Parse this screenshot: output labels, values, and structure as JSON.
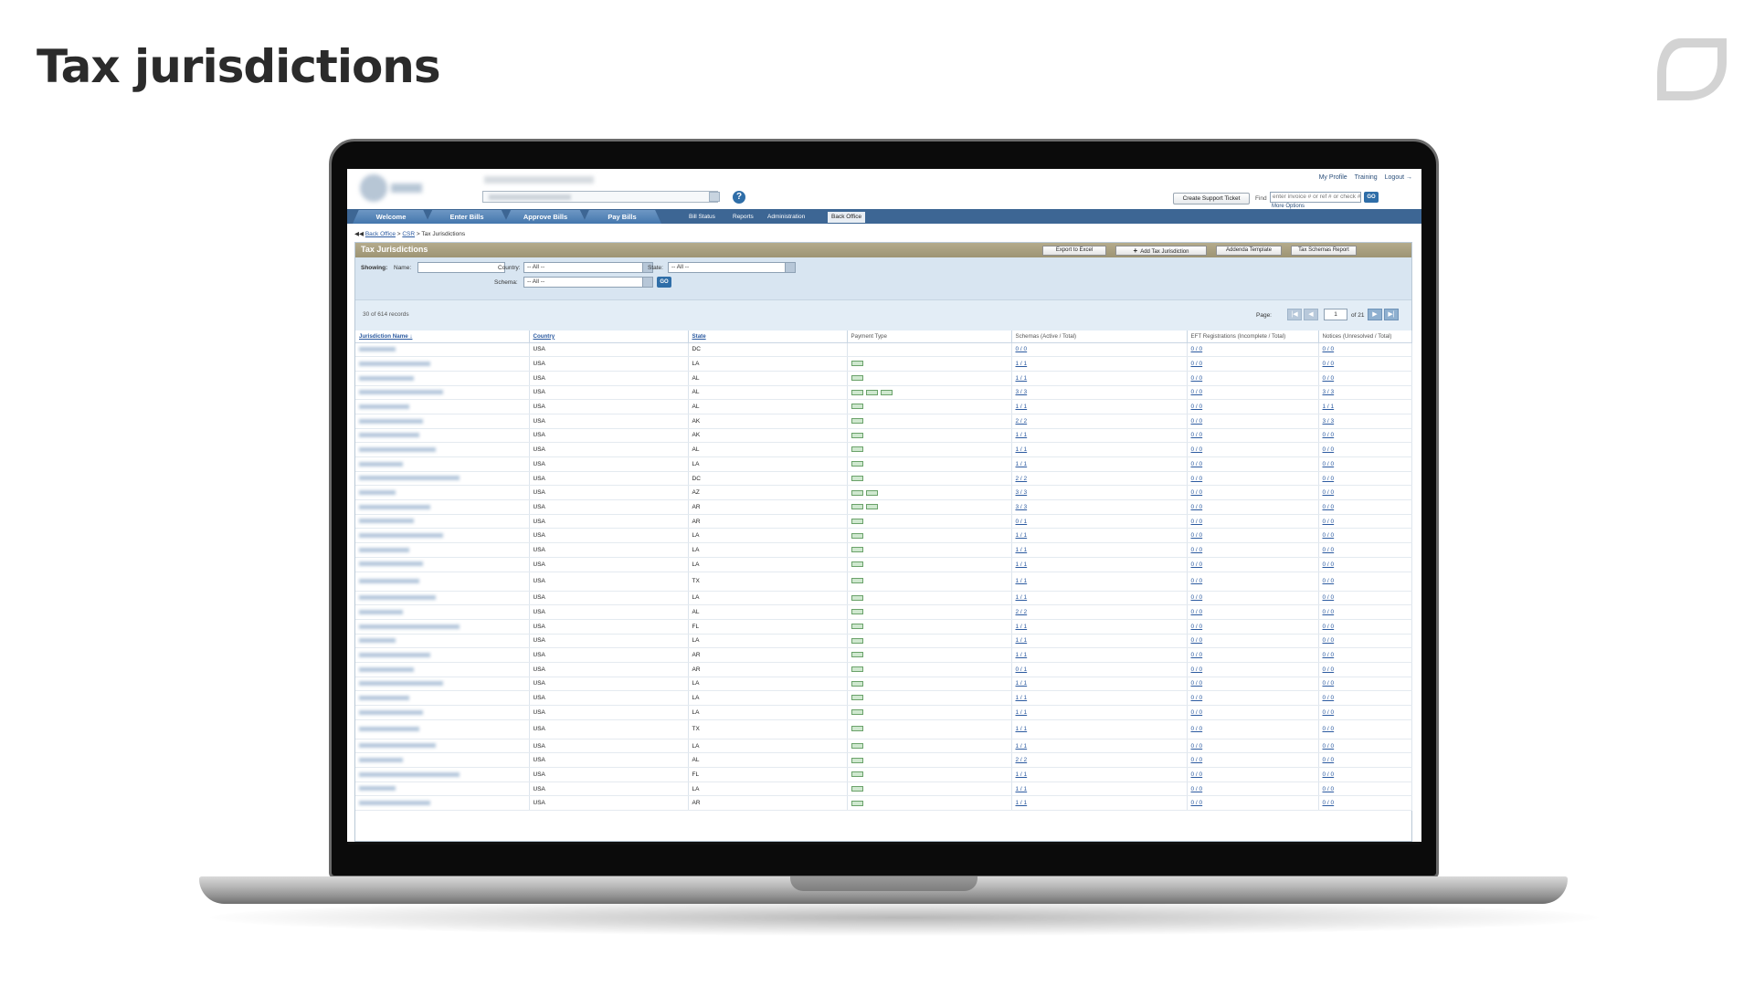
{
  "slide": {
    "title": "Tax jurisdictions"
  },
  "app": {
    "toplinks": [
      "My Profile",
      "Training",
      "Logout →"
    ],
    "help_label": "?",
    "support_button": "Create Support Ticket",
    "find_label": "Find",
    "find_placeholder": "enter invoice # or ref # or check #",
    "find_go": "GO",
    "more_options": "More Options",
    "nav_tabs": [
      "Welcome",
      "Enter Bills",
      "Approve Bills",
      "Pay Bills"
    ],
    "sub_tabs": [
      "Bill Status",
      "Reports",
      "Administration",
      "Back Office"
    ],
    "breadcrumb": {
      "arrow": "◀◀",
      "items": [
        "Back Office",
        "CSR"
      ],
      "sep": ">",
      "current": "Tax Jurisdictions"
    },
    "panel": {
      "title": "Tax Jurisdictions",
      "buttons": [
        "Export to Excel",
        "Add Tax Jurisdiction",
        "Addenda Template",
        "Tax Schemas Report"
      ],
      "add_icon": "+"
    },
    "filters": {
      "showing": "Showing:",
      "name_label": "Name:",
      "name_value": "",
      "country_label": "Country:",
      "country_value": "-- All --",
      "state_label": "State:",
      "state_value": "-- All --",
      "schema_label": "Schema:",
      "schema_value": "-- All --",
      "go": "GO"
    },
    "pager": {
      "records": "30 of 614 records",
      "page_label": "Page:",
      "page_value": "1",
      "of_pages": "of 21",
      "first": "|◀",
      "prev": "◀",
      "next": "▶",
      "last": "▶|"
    },
    "columns": [
      "Jurisdiction Name ↓",
      "Country",
      "State",
      "Payment Type",
      "Schemas (Active / Total)",
      "EFT Registrations (Incomplete / Total)",
      "Notices (Unresolved / Total)"
    ],
    "rows": [
      {
        "country": "USA",
        "state": "DC",
        "badges": 0,
        "schemas": "0 / 0",
        "eft": "0 / 0",
        "notices": "0 / 0"
      },
      {
        "country": "USA",
        "state": "LA",
        "badges": 1,
        "schemas": "1 / 1",
        "eft": "0 / 0",
        "notices": "0 / 0"
      },
      {
        "country": "USA",
        "state": "AL",
        "badges": 1,
        "schemas": "1 / 1",
        "eft": "0 / 0",
        "notices": "0 / 0"
      },
      {
        "country": "USA",
        "state": "AL",
        "badges": 3,
        "schemas": "3 / 3",
        "eft": "0 / 0",
        "notices": "3 / 3"
      },
      {
        "country": "USA",
        "state": "AL",
        "badges": 1,
        "schemas": "1 / 1",
        "eft": "0 / 0",
        "notices": "1 / 1"
      },
      {
        "country": "USA",
        "state": "AK",
        "badges": 1,
        "schemas": "2 / 2",
        "eft": "0 / 0",
        "notices": "3 / 3"
      },
      {
        "country": "USA",
        "state": "AK",
        "badges": 1,
        "schemas": "1 / 1",
        "eft": "0 / 0",
        "notices": "0 / 0"
      },
      {
        "country": "USA",
        "state": "AL",
        "badges": 1,
        "schemas": "1 / 1",
        "eft": "0 / 0",
        "notices": "0 / 0"
      },
      {
        "country": "USA",
        "state": "LA",
        "badges": 1,
        "schemas": "1 / 1",
        "eft": "0 / 0",
        "notices": "0 / 0"
      },
      {
        "country": "USA",
        "state": "DC",
        "badges": 1,
        "schemas": "2 / 2",
        "eft": "0 / 0",
        "notices": "0 / 0"
      },
      {
        "country": "USA",
        "state": "AZ",
        "badges": 2,
        "schemas": "3 / 3",
        "eft": "0 / 0",
        "notices": "0 / 0"
      },
      {
        "country": "USA",
        "state": "AR",
        "badges": 2,
        "schemas": "3 / 3",
        "eft": "0 / 0",
        "notices": "0 / 0"
      },
      {
        "country": "USA",
        "state": "AR",
        "badges": 1,
        "schemas": "0 / 1",
        "eft": "0 / 0",
        "notices": "0 / 0"
      },
      {
        "country": "USA",
        "state": "LA",
        "badges": 1,
        "schemas": "1 / 1",
        "eft": "0 / 0",
        "notices": "0 / 0"
      },
      {
        "country": "USA",
        "state": "LA",
        "badges": 1,
        "schemas": "1 / 1",
        "eft": "0 / 0",
        "notices": "0 / 0"
      },
      {
        "country": "USA",
        "state": "LA",
        "badges": 1,
        "schemas": "1 / 1",
        "eft": "0 / 0",
        "notices": "0 / 0"
      },
      {
        "country": "USA",
        "state": "TX",
        "badges": 1,
        "schemas": "1 / 1",
        "eft": "0 / 0",
        "notices": "0 / 0",
        "tall": true
      },
      {
        "country": "USA",
        "state": "LA",
        "badges": 1,
        "schemas": "1 / 1",
        "eft": "0 / 0",
        "notices": "0 / 0"
      },
      {
        "country": "USA",
        "state": "AL",
        "badges": 1,
        "schemas": "2 / 2",
        "eft": "0 / 0",
        "notices": "0 / 0"
      },
      {
        "country": "USA",
        "state": "FL",
        "badges": 1,
        "schemas": "1 / 1",
        "eft": "0 / 0",
        "notices": "0 / 0"
      },
      {
        "country": "USA",
        "state": "LA",
        "badges": 1,
        "schemas": "1 / 1",
        "eft": "0 / 0",
        "notices": "0 / 0"
      },
      {
        "country": "USA",
        "state": "AR",
        "badges": 1,
        "schemas": "1 / 1",
        "eft": "0 / 0",
        "notices": "0 / 0"
      },
      {
        "country": "USA",
        "state": "AR",
        "badges": 1,
        "schemas": "0 / 1",
        "eft": "0 / 0",
        "notices": "0 / 0"
      },
      {
        "country": "USA",
        "state": "LA",
        "badges": 1,
        "schemas": "1 / 1",
        "eft": "0 / 0",
        "notices": "0 / 0"
      },
      {
        "country": "USA",
        "state": "LA",
        "badges": 1,
        "schemas": "1 / 1",
        "eft": "0 / 0",
        "notices": "0 / 0"
      },
      {
        "country": "USA",
        "state": "LA",
        "badges": 1,
        "schemas": "1 / 1",
        "eft": "0 / 0",
        "notices": "0 / 0"
      },
      {
        "country": "USA",
        "state": "TX",
        "badges": 1,
        "schemas": "1 / 1",
        "eft": "0 / 0",
        "notices": "0 / 0",
        "tall": true
      },
      {
        "country": "USA",
        "state": "LA",
        "badges": 1,
        "schemas": "1 / 1",
        "eft": "0 / 0",
        "notices": "0 / 0"
      },
      {
        "country": "USA",
        "state": "AL",
        "badges": 1,
        "schemas": "2 / 2",
        "eft": "0 / 0",
        "notices": "0 / 0"
      },
      {
        "country": "USA",
        "state": "FL",
        "badges": 1,
        "schemas": "1 / 1",
        "eft": "0 / 0",
        "notices": "0 / 0"
      },
      {
        "country": "USA",
        "state": "LA",
        "badges": 1,
        "schemas": "1 / 1",
        "eft": "0 / 0",
        "notices": "0 / 0"
      },
      {
        "country": "USA",
        "state": "AR",
        "badges": 1,
        "schemas": "1 / 1",
        "eft": "0 / 0",
        "notices": "0 / 0"
      }
    ]
  },
  "colors": {
    "nav": "#3d6694",
    "panel_title": "#a39a7b",
    "filter_bg": "#d8e5f1",
    "link": "#2b5aa0"
  }
}
